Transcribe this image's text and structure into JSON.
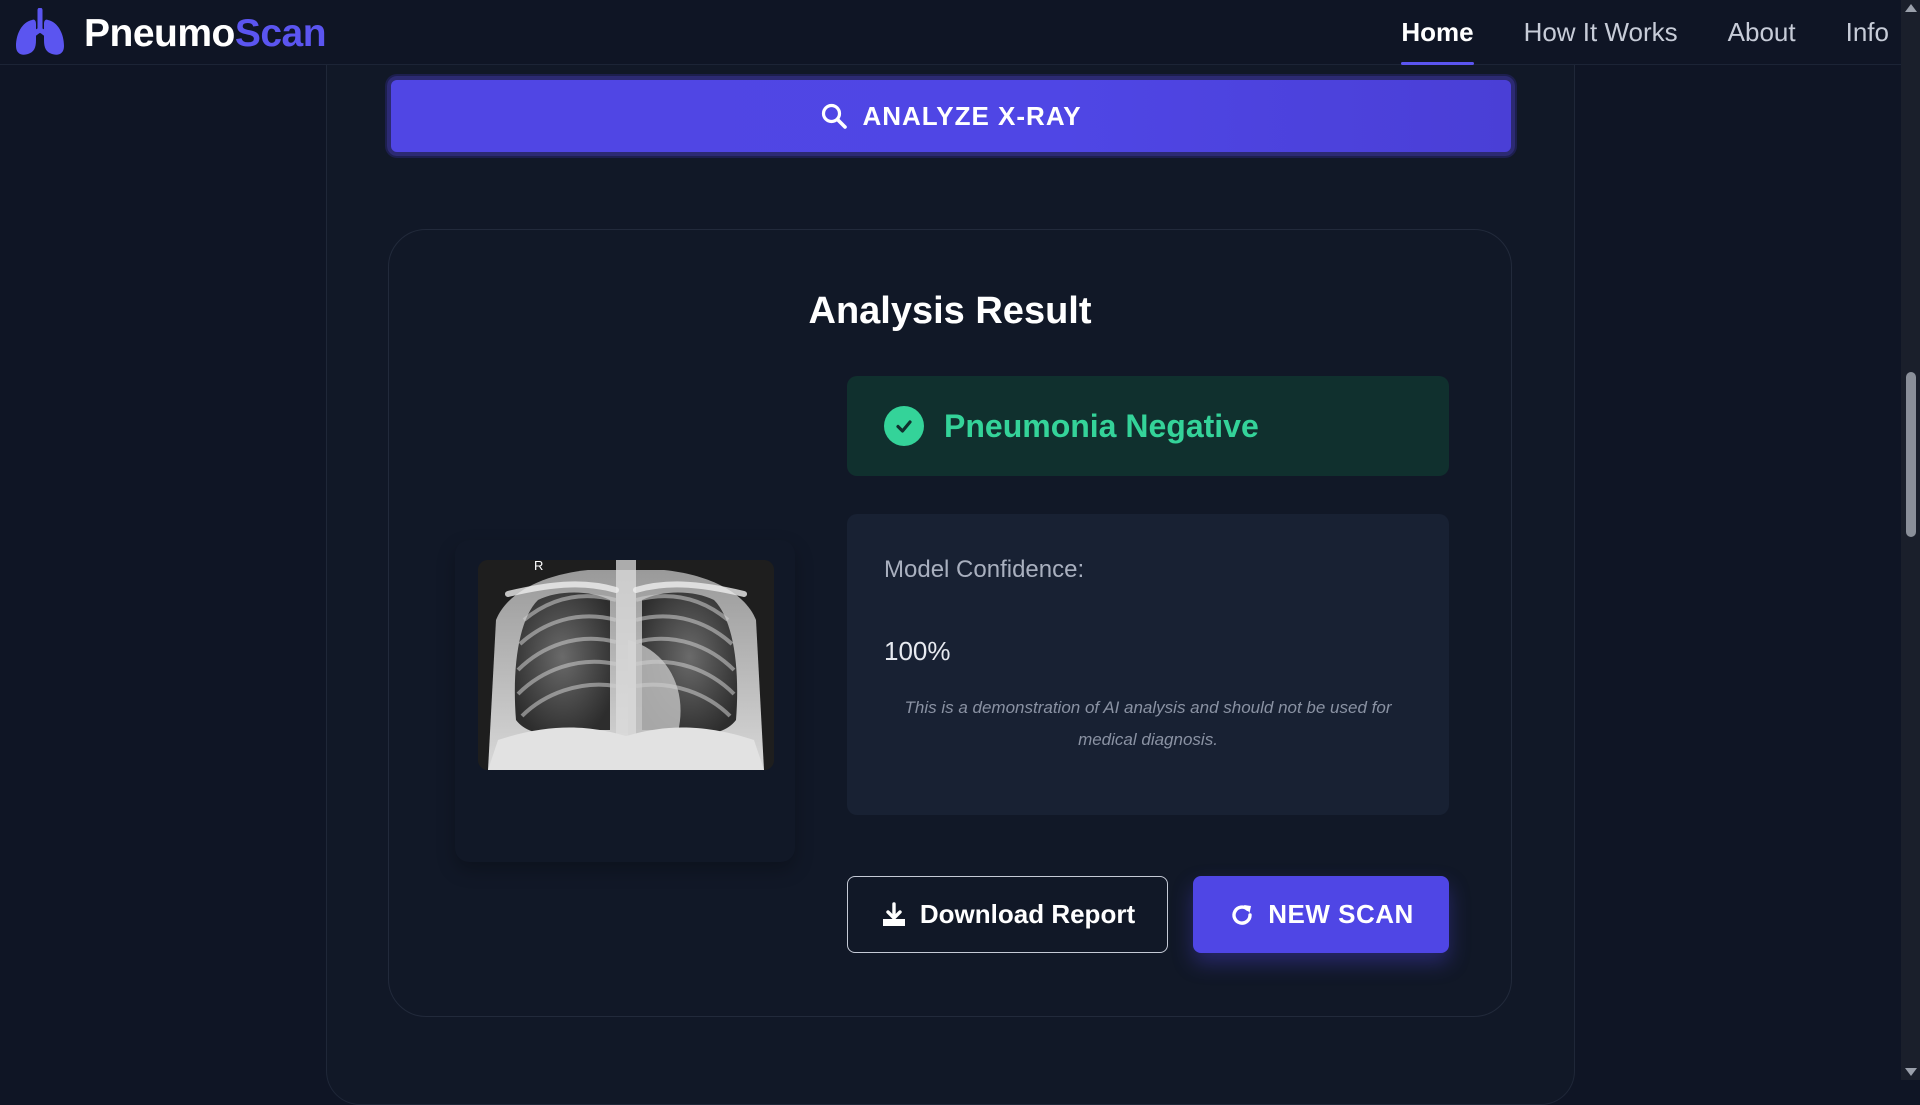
{
  "header": {
    "brand_part1": "Pneumo",
    "brand_part2": "Scan",
    "logo_icon": "lungs-icon",
    "nav": [
      {
        "label": "Home",
        "active": true
      },
      {
        "label": "How It Works",
        "active": false
      },
      {
        "label": "About",
        "active": false
      },
      {
        "label": "Info",
        "active": false
      }
    ]
  },
  "analyze": {
    "label": "ANALYZE X-RAY",
    "icon": "search-icon"
  },
  "result": {
    "title": "Analysis Result",
    "status_text": "Pneumonia Negative",
    "status_icon": "check-circle-icon",
    "xray_marker": "R",
    "confidence_label": "Model Confidence:",
    "confidence_value": "100%",
    "disclaimer": "This is a demonstration of AI analysis and should not be used for medical diagnosis.",
    "download_label": "Download Report",
    "download_icon": "download-icon",
    "newscan_label": "NEW SCAN",
    "newscan_icon": "refresh-icon"
  },
  "colors": {
    "accent": "#4f46e5",
    "brand_accent": "#5b55f0",
    "success": "#34d399",
    "background": "#0f1525"
  }
}
